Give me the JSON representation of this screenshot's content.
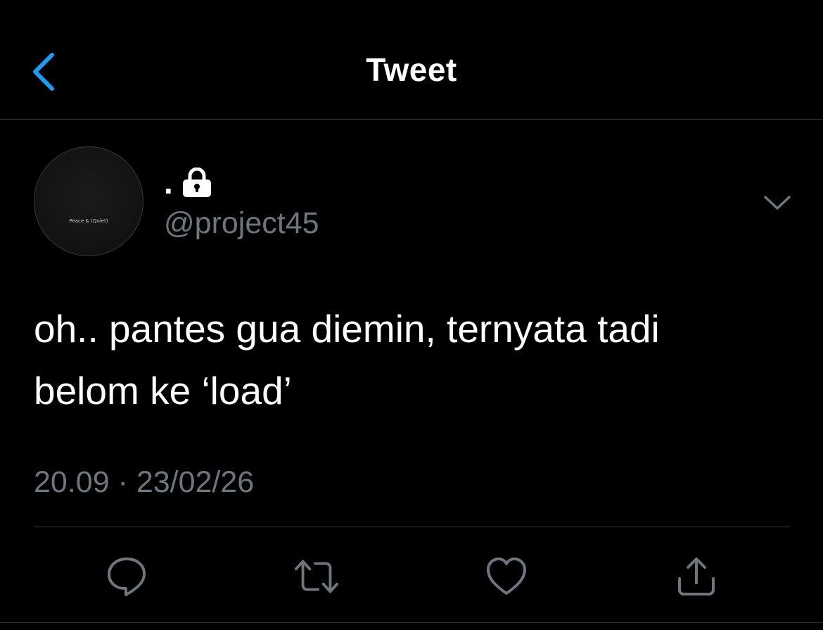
{
  "header": {
    "title": "Tweet",
    "back_icon": "chevron-left-icon"
  },
  "author": {
    "display_name": ".",
    "handle": "@project45",
    "avatar_caption": "Peace & (Quiet)",
    "protected_icon": "lock-icon"
  },
  "tweet": {
    "text_line1": "oh.. pantes gua diemin, ternyata tadi",
    "text_line2": "belom ke ‘load’",
    "timestamp": "20.09 · 23/02/26"
  },
  "actions": {
    "reply_icon": "reply-icon",
    "retweet_icon": "retweet-icon",
    "like_icon": "heart-icon",
    "share_icon": "share-icon"
  },
  "colors": {
    "background": "#000000",
    "accent": "#1d9bf0",
    "secondary_text": "#6e767d",
    "divider": "#2f3336"
  }
}
